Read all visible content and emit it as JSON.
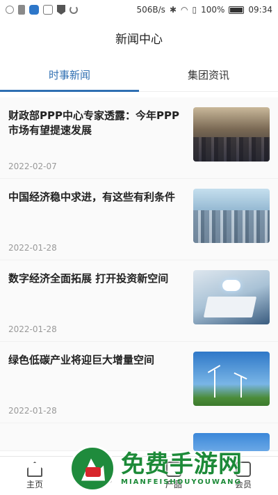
{
  "statusbar": {
    "network_speed": "506B/s",
    "battery": "100%",
    "time": "09:34",
    "icons": [
      "infinity-icon",
      "sim-icon",
      "app-icon",
      "square-icon",
      "shield-icon",
      "sync-icon",
      "bluetooth-icon",
      "wifi-icon",
      "alert-sim-icon",
      "battery-icon"
    ]
  },
  "header": {
    "title": "新闻中心"
  },
  "tabs": [
    {
      "label": "时事新闻",
      "active": true
    },
    {
      "label": "集团资讯",
      "active": false
    }
  ],
  "news": [
    {
      "title": "财政部PPP中心专家透露：今年PPP市场有望提速发展",
      "date": "2022-02-07",
      "image": "city-handshake"
    },
    {
      "title": "中国经济稳中求进，有这些有利条件",
      "date": "2022-01-28",
      "image": "city-skyline"
    },
    {
      "title": "数字经济全面拓展 打开投资新空间",
      "date": "2022-01-28",
      "image": "laptop-cloud"
    },
    {
      "title": "绿色低碳产业将迎巨大增量空间",
      "date": "2022-01-28",
      "image": "wind-turbines"
    },
    {
      "title": "",
      "date": "",
      "image": "partial"
    }
  ],
  "bottom_nav": [
    {
      "label": "主页",
      "icon": "home-icon"
    },
    {
      "label": "",
      "icon": "grid-icon"
    },
    {
      "label": "产品",
      "icon": "product-icon"
    },
    {
      "label": "会员",
      "icon": "member-icon"
    }
  ],
  "watermark": {
    "main": "免费手游网",
    "sub": "MIANFEISHOUYOUWANG"
  }
}
